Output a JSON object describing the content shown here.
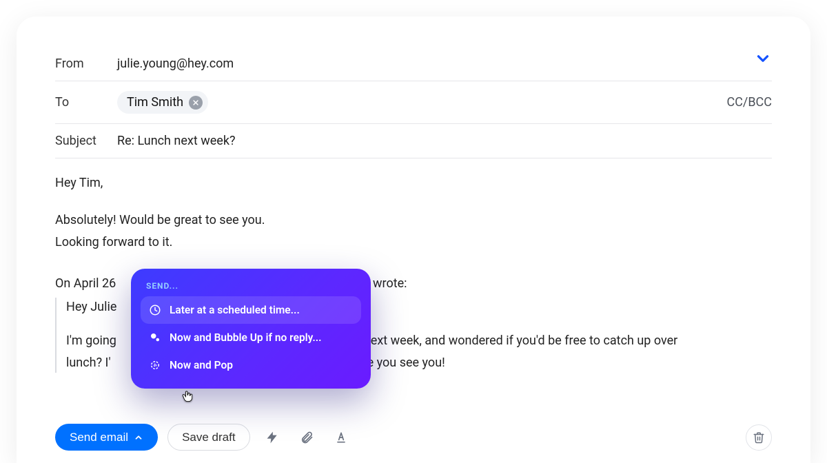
{
  "header": {
    "from_label": "From",
    "from_value": "julie.young@hey.com",
    "to_label": "To",
    "to_chip": "Tim Smith",
    "ccbcc_label": "CC/BCC",
    "subject_label": "Subject",
    "subject_value": "Re: Lunch next week?"
  },
  "body": {
    "greeting": "Hey Tim,",
    "line1": "Absolutely! Would be great to see you.",
    "line2": "Looking forward to it.",
    "quote_meta_prefix": "On April 26",
    "quote_meta_suffix": "> wrote:",
    "quote_greeting": "Hey Julie",
    "quote_line1_a": "I'm going",
    "quote_line1_b": "next week, and wondered if you'd be free to catch up over",
    "quote_line2_a": "lunch? I'",
    "quote_line2_b": "love you see you!"
  },
  "toolbar": {
    "send_label": "Send email",
    "save_draft_label": "Save draft"
  },
  "send_menu": {
    "title": "SEND...",
    "items": [
      {
        "label": "Later at a scheduled time...",
        "icon": "clock"
      },
      {
        "label": "Now and Bubble Up if no reply...",
        "icon": "bubble"
      },
      {
        "label": "Now and Pop",
        "icon": "pop"
      }
    ]
  },
  "colors": {
    "primary": "#0071ff",
    "menu_gradient_start": "#3d3cff",
    "menu_gradient_end": "#6a1bff"
  }
}
